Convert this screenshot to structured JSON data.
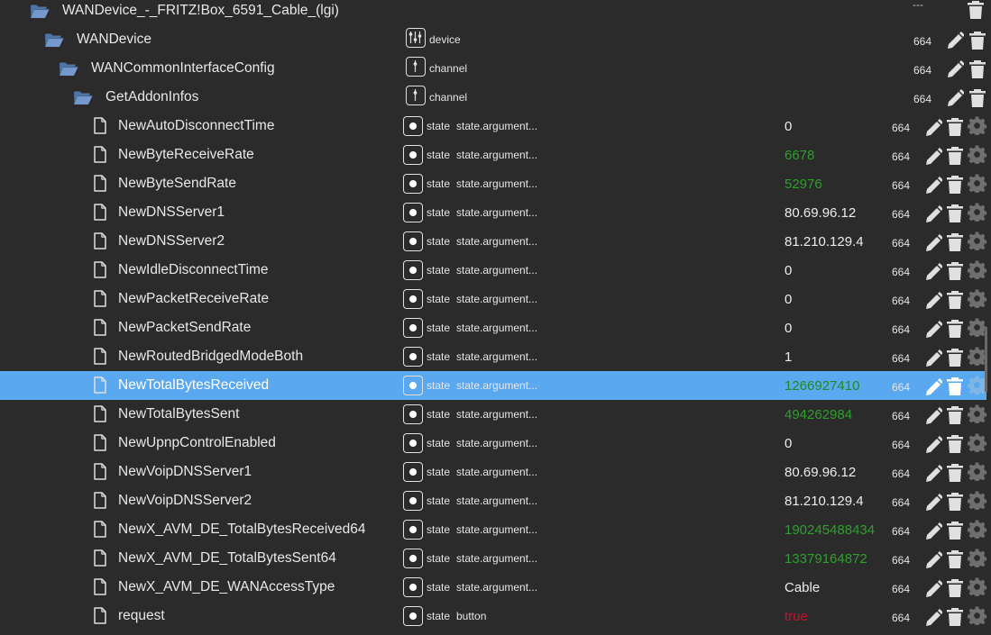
{
  "tree": {
    "root": {
      "name": "WANDevice_-_FRITZ!Box_6591_Cable_(lgi)",
      "acl": "---"
    },
    "groups": [
      {
        "name": "WANDevice",
        "type": "device",
        "acl": "664"
      },
      {
        "name": "WANCommonInterfaceConfig",
        "type": "channel",
        "acl": "664"
      },
      {
        "name": "GetAddonInfos",
        "type": "channel",
        "acl": "664"
      }
    ],
    "states": [
      {
        "name": "NewAutoDisconnectTime",
        "type": "state",
        "role": "state.argument...",
        "value": "0",
        "color": "plain",
        "acl": "664"
      },
      {
        "name": "NewByteReceiveRate",
        "type": "state",
        "role": "state.argument...",
        "value": "6678",
        "color": "green",
        "acl": "664"
      },
      {
        "name": "NewByteSendRate",
        "type": "state",
        "role": "state.argument...",
        "value": "52976",
        "color": "green",
        "acl": "664"
      },
      {
        "name": "NewDNSServer1",
        "type": "state",
        "role": "state.argument...",
        "value": "80.69.96.12",
        "color": "plain",
        "acl": "664"
      },
      {
        "name": "NewDNSServer2",
        "type": "state",
        "role": "state.argument...",
        "value": "81.210.129.4",
        "color": "plain",
        "acl": "664"
      },
      {
        "name": "NewIdleDisconnectTime",
        "type": "state",
        "role": "state.argument...",
        "value": "0",
        "color": "plain",
        "acl": "664"
      },
      {
        "name": "NewPacketReceiveRate",
        "type": "state",
        "role": "state.argument...",
        "value": "0",
        "color": "plain",
        "acl": "664"
      },
      {
        "name": "NewPacketSendRate",
        "type": "state",
        "role": "state.argument...",
        "value": "0",
        "color": "plain",
        "acl": "664"
      },
      {
        "name": "NewRoutedBridgedModeBoth",
        "type": "state",
        "role": "state.argument...",
        "value": "1",
        "color": "plain",
        "acl": "664"
      },
      {
        "name": "NewTotalBytesReceived",
        "type": "state",
        "role": "state.argument...",
        "value": "1266927410",
        "color": "green",
        "acl": "664",
        "selected": true
      },
      {
        "name": "NewTotalBytesSent",
        "type": "state",
        "role": "state.argument...",
        "value": "494262984",
        "color": "green",
        "acl": "664"
      },
      {
        "name": "NewUpnpControlEnabled",
        "type": "state",
        "role": "state.argument...",
        "value": "0",
        "color": "plain",
        "acl": "664"
      },
      {
        "name": "NewVoipDNSServer1",
        "type": "state",
        "role": "state.argument...",
        "value": "80.69.96.12",
        "color": "plain",
        "acl": "664"
      },
      {
        "name": "NewVoipDNSServer2",
        "type": "state",
        "role": "state.argument...",
        "value": "81.210.129.4",
        "color": "plain",
        "acl": "664"
      },
      {
        "name": "NewX_AVM_DE_TotalBytesReceived64",
        "type": "state",
        "role": "state.argument...",
        "value": "190245488434",
        "color": "green",
        "acl": "664"
      },
      {
        "name": "NewX_AVM_DE_TotalBytesSent64",
        "type": "state",
        "role": "state.argument...",
        "value": "13379164872",
        "color": "green",
        "acl": "664"
      },
      {
        "name": "NewX_AVM_DE_WANAccessType",
        "type": "state",
        "role": "state.argument...",
        "value": "Cable",
        "color": "plain",
        "acl": "664"
      },
      {
        "name": "request",
        "type": "state",
        "role": "button",
        "value": "true",
        "color": "red",
        "acl": "664"
      }
    ]
  },
  "icons": {
    "folder": "folder-open-icon",
    "file": "file-icon",
    "device": "device-icon",
    "channel": "channel-icon",
    "state": "state-icon",
    "edit": "pencil-icon",
    "delete": "trash-icon",
    "config": "gear-icon"
  },
  "colors": {
    "background": "#2b2b2b",
    "selected_row": "#5aa9f0",
    "folder": "#6b8fbf",
    "value_green": "#2e9e2e",
    "value_red": "#c8102e"
  }
}
